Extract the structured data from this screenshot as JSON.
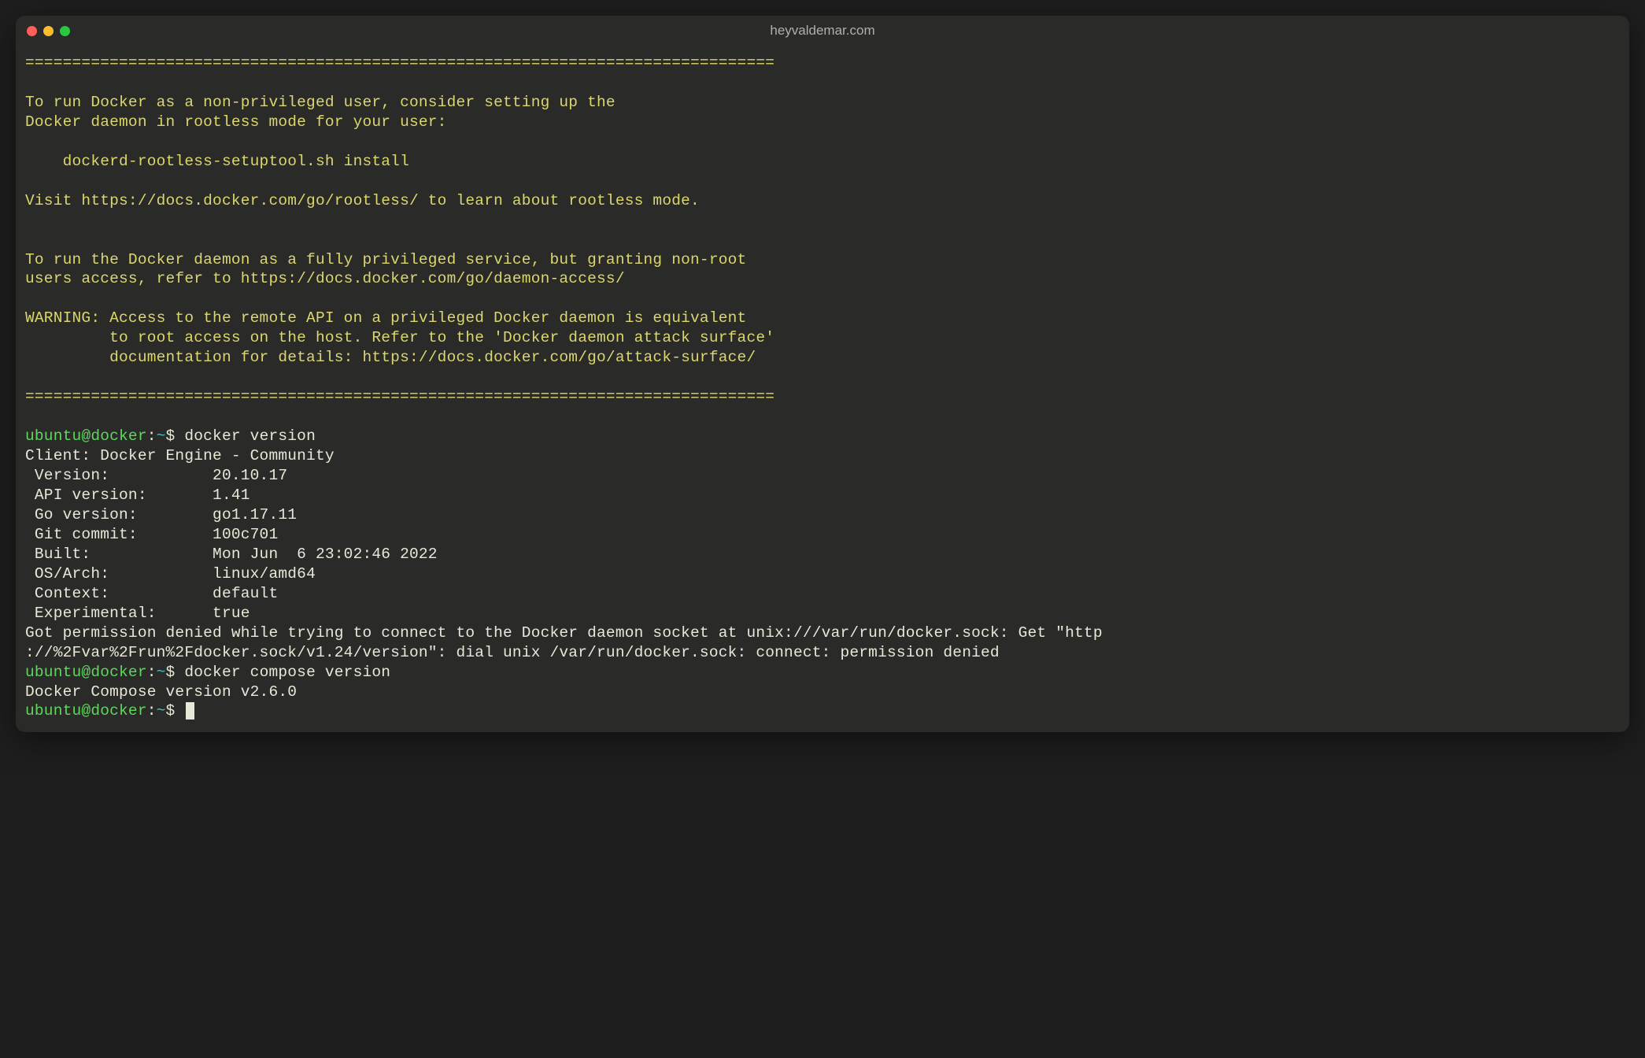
{
  "window": {
    "title": "heyvaldemar.com"
  },
  "terminal": {
    "divider": "================================================================================",
    "msg1_l1": "To run Docker as a non-privileged user, consider setting up the",
    "msg1_l2": "Docker daemon in rootless mode for your user:",
    "msg1_cmd": "    dockerd-rootless-setuptool.sh install",
    "msg1_l3": "Visit https://docs.docker.com/go/rootless/ to learn about rootless mode.",
    "msg2_l1": "To run the Docker daemon as a fully privileged service, but granting non-root",
    "msg2_l2": "users access, refer to https://docs.docker.com/go/daemon-access/",
    "warn_l1": "WARNING: Access to the remote API on a privileged Docker daemon is equivalent",
    "warn_l2": "         to root access on the host. Refer to the 'Docker daemon attack surface'",
    "warn_l3": "         documentation for details: https://docs.docker.com/go/attack-surface/",
    "prompt": {
      "user": "ubuntu@docker",
      "sep": ":",
      "path": "~",
      "symbol": "$"
    },
    "cmd1": " docker version",
    "client_header": "Client: Docker Engine - Community",
    "client": {
      "version_k": " Version:           ",
      "version_v": "20.10.17",
      "api_k": " API version:       ",
      "api_v": "1.41",
      "go_k": " Go version:        ",
      "go_v": "go1.17.11",
      "git_k": " Git commit:        ",
      "git_v": "100c701",
      "built_k": " Built:             ",
      "built_v": "Mon Jun  6 23:02:46 2022",
      "os_k": " OS/Arch:           ",
      "os_v": "linux/amd64",
      "ctx_k": " Context:           ",
      "ctx_v": "default",
      "exp_k": " Experimental:      ",
      "exp_v": "true"
    },
    "perm_err_l1": "Got permission denied while trying to connect to the Docker daemon socket at unix:///var/run/docker.sock: Get \"http",
    "perm_err_l2": "://%2Fvar%2Frun%2Fdocker.sock/v1.24/version\": dial unix /var/run/docker.sock: connect: permission denied",
    "cmd2": " docker compose version",
    "compose_out": "Docker Compose version v2.6.0"
  }
}
